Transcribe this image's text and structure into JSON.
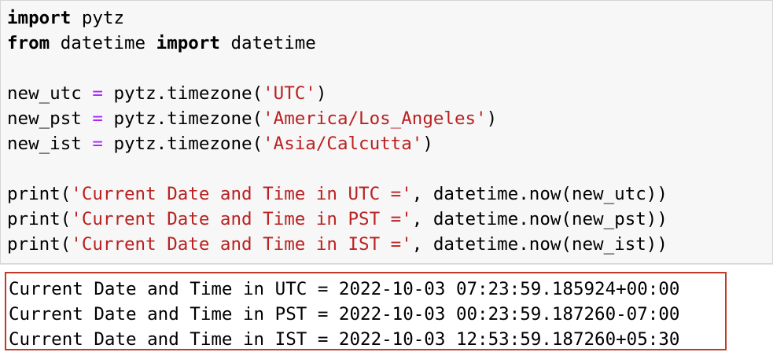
{
  "code": {
    "line1": {
      "kw": "import",
      "rest": " pytz"
    },
    "line2": {
      "kw1": "from",
      "mid": " datetime ",
      "kw2": "import",
      "rest": " datetime"
    },
    "line4": {
      "var": "new_utc ",
      "op": "=",
      "fn": " pytz.timezone(",
      "str": "'UTC'",
      "end": ")"
    },
    "line5": {
      "var": "new_pst ",
      "op": "=",
      "fn": " pytz.timezone(",
      "str": "'America/Los_Angeles'",
      "end": ")"
    },
    "line6": {
      "var": "new_ist ",
      "op": "=",
      "fn": " pytz.timezone(",
      "str": "'Asia/Calcutta'",
      "end": ")"
    },
    "line8": {
      "fn": "print(",
      "str": "'Current Date and Time in UTC ='",
      "end": ", datetime.now(new_utc))"
    },
    "line9": {
      "fn": "print(",
      "str": "'Current Date and Time in PST ='",
      "end": ", datetime.now(new_pst))"
    },
    "line10": {
      "fn": "print(",
      "str": "'Current Date and Time in IST ='",
      "end": ", datetime.now(new_ist))"
    }
  },
  "output": {
    "lines": [
      "Current Date and Time in UTC = 2022-10-03 07:23:59.185924+00:00",
      "Current Date and Time in PST = 2022-10-03 00:23:59.187260-07:00",
      "Current Date and Time in IST = 2022-10-03 12:53:59.187260+05:30"
    ]
  },
  "colors": {
    "keyword": "#000000",
    "operator": "#aa22ff",
    "string": "#ba2121",
    "highlight_border": "#c0392b"
  }
}
